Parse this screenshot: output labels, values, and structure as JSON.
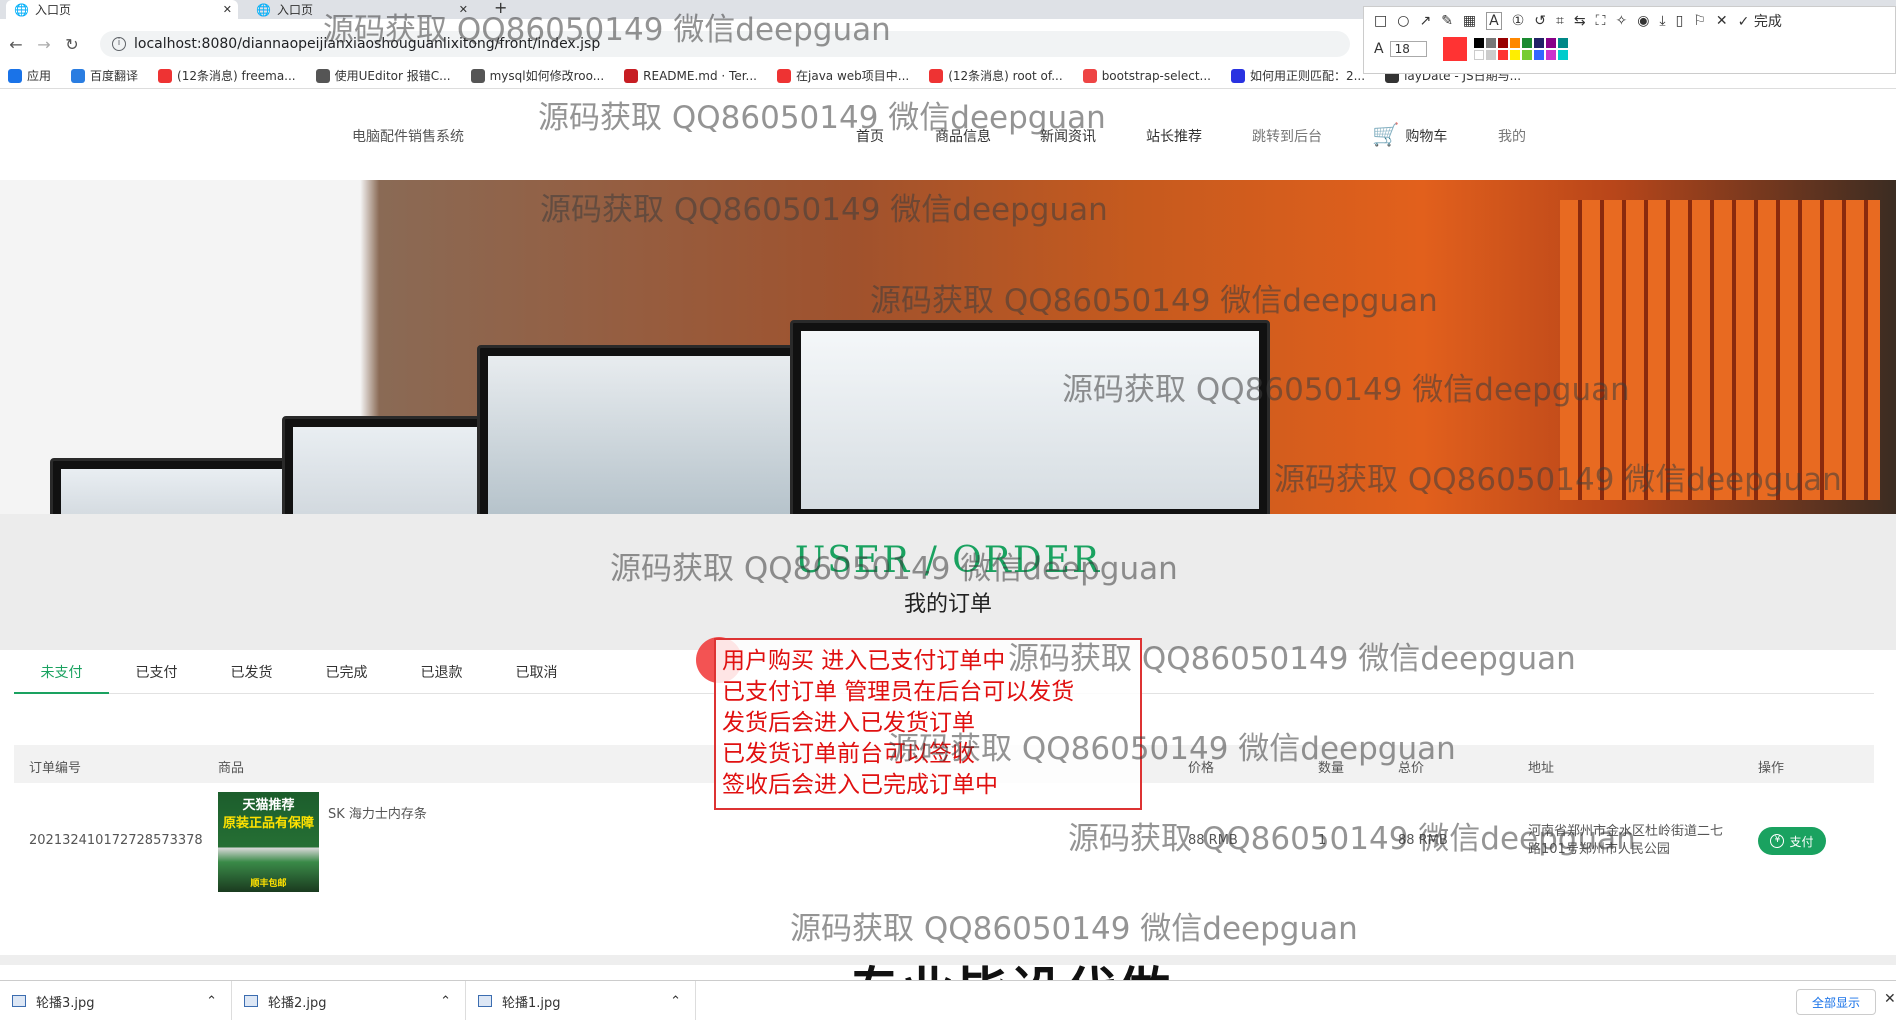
{
  "browser": {
    "tabs": [
      {
        "label": "入口页",
        "active": true
      },
      {
        "label": "入口页",
        "active": false
      }
    ],
    "url": "localhost:8080/diannaopeijianxiaoshouguanlixitong/front/index.jsp",
    "bookmarks": [
      {
        "label": "应用",
        "icon": "apps-icon",
        "color": "#1a73e8"
      },
      {
        "label": "百度翻译",
        "icon": "translate-icon",
        "color": "#2a7de1"
      },
      {
        "label": "(12条消息) freema...",
        "icon": "csdn-icon",
        "color": "#e33"
      },
      {
        "label": "使用UEditor 报错C...",
        "icon": "web-icon",
        "color": "#555"
      },
      {
        "label": "mysql如何修改roo...",
        "icon": "web-icon",
        "color": "#555"
      },
      {
        "label": "README.md · Ter...",
        "icon": "gitee-icon",
        "color": "#c71d23"
      },
      {
        "label": "在java web项目中...",
        "icon": "csdn-icon",
        "color": "#e33"
      },
      {
        "label": "(12条消息) root of...",
        "icon": "csdn-icon",
        "color": "#e33"
      },
      {
        "label": "bootstrap-select...",
        "icon": "web-icon",
        "color": "#e44"
      },
      {
        "label": "如何用正则匹配：2...",
        "icon": "baidu-icon",
        "color": "#2932e1"
      },
      {
        "label": "layDate - JS日期与...",
        "icon": "layui-icon",
        "color": "#333"
      }
    ]
  },
  "annotation_toolbar": {
    "font_size": "18",
    "done_label": "完成"
  },
  "site": {
    "brand": "电脑配件销售系统",
    "nav": [
      "首页",
      "商品信息",
      "新闻资讯",
      "站长推荐",
      "跳转到后台",
      "购物车",
      "我的"
    ]
  },
  "section": {
    "title_en": "USER / ORDER",
    "title_cn": "我的订单"
  },
  "order_tabs": [
    "未支付",
    "已支付",
    "已发货",
    "已完成",
    "已退款",
    "已取消"
  ],
  "table": {
    "headers": [
      "订单编号",
      "商品",
      "价格",
      "数量",
      "总价",
      "地址",
      "操作"
    ],
    "rows": [
      {
        "order_no": "20213241017272857337​8",
        "product": "SK 海力士内存条",
        "image_text_1": "天猫推荐",
        "image_text_2": "原装正品有保障",
        "image_text_3": "顺丰包邮",
        "price": "88 RMB",
        "qty": "1",
        "total": "88 RMB",
        "address": "河南省郑州市金水区杜岭街道二七路101号郑州市人民公园",
        "action": "支付"
      }
    ]
  },
  "annotation_note": [
    "用户购买  进入已支付订单中",
    "已支付订单 管理员在后台可以发货",
    "发货后会进入已发货订单",
    "已发货订单前台可以签收",
    "签收后会进入已完成订单中"
  ],
  "watermark": "源码获取 QQ86050149 微信deepguan",
  "promo": "专业毕设代做",
  "downloads": {
    "items": [
      "轮播3.jpg",
      "轮播2.jpg",
      "轮播1.jpg"
    ],
    "show_all": "全部显示"
  }
}
